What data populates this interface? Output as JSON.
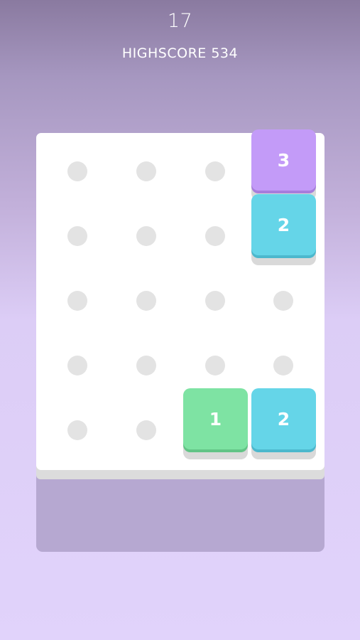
{
  "header": {
    "score": "17",
    "highscore_label": "HIGHSCORE 534"
  },
  "board": {
    "columns": 4,
    "rows": 5,
    "background": "#ffffff",
    "empty_dot_color": "#e3e3e3"
  },
  "tiles": [
    {
      "value": "3",
      "column": 4,
      "row": 1,
      "face_color": "#c39bf8",
      "edge_color": "#a77ddc"
    },
    {
      "value": "2",
      "column": 4,
      "row": 2,
      "face_color": "#65d5e8",
      "edge_color": "#4cb8cd"
    },
    {
      "value": "1",
      "column": 3,
      "row": 5,
      "face_color": "#7ee3a3",
      "edge_color": "#62c486"
    },
    {
      "value": "2",
      "column": 4,
      "row": 5,
      "face_color": "#65d5e8",
      "edge_color": "#4cb8cd"
    }
  ],
  "colors": {
    "background_top": "#8a7aa0",
    "background_bottom": "#e1d3fb",
    "board_shadow": "#b6a8d1"
  }
}
